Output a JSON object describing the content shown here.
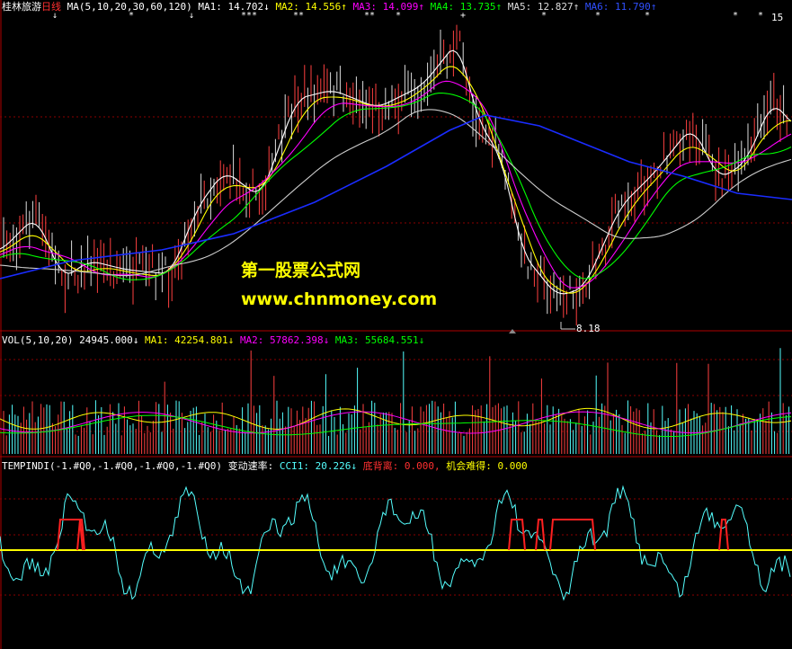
{
  "price_panel": {
    "stock_name": "桂林旅游",
    "period": "日线",
    "indicator": "MA(5,10,20,30,60,120)",
    "ma1": "MA1: 14.702↓",
    "ma2": "MA2: 14.556↑",
    "ma3": "MA3: 14.099↑",
    "ma4": "MA4: 13.735↑",
    "ma5": "MA5: 12.827↑",
    "ma6": "MA6: 11.790↑",
    "right_edge_price": "15",
    "low_marker": "8.18",
    "colors": {
      "ma1": "#ffffff",
      "ma2": "#ffff00",
      "ma3": "#ff00ff",
      "ma4": "#00ff00",
      "ma5": "#dddddd",
      "ma6": "#0000ff",
      "up": "#ff4040",
      "down": "#54ffff"
    }
  },
  "watermark": {
    "line1": "第一股票公式网",
    "line2": "www.chnmoney.com"
  },
  "volume_panel": {
    "indicator": "VOL(5,10,20)",
    "vol": "24945.000↓",
    "ma1": "MA1: 42254.801↓",
    "ma2": "MA2: 57862.398↓",
    "ma3": "MA3: 55684.551↓"
  },
  "tempindi_panel": {
    "indicator": "TEMPINDI(-1.#Q0,-1.#Q0,-1.#Q0,-1.#Q0)",
    "label_speed": "变动速率:",
    "cci1": "CCI1: 20.226↓",
    "bottom_divergence": "底背离: 0.000,",
    "opportunity": "机会难得: 0.000"
  }
}
